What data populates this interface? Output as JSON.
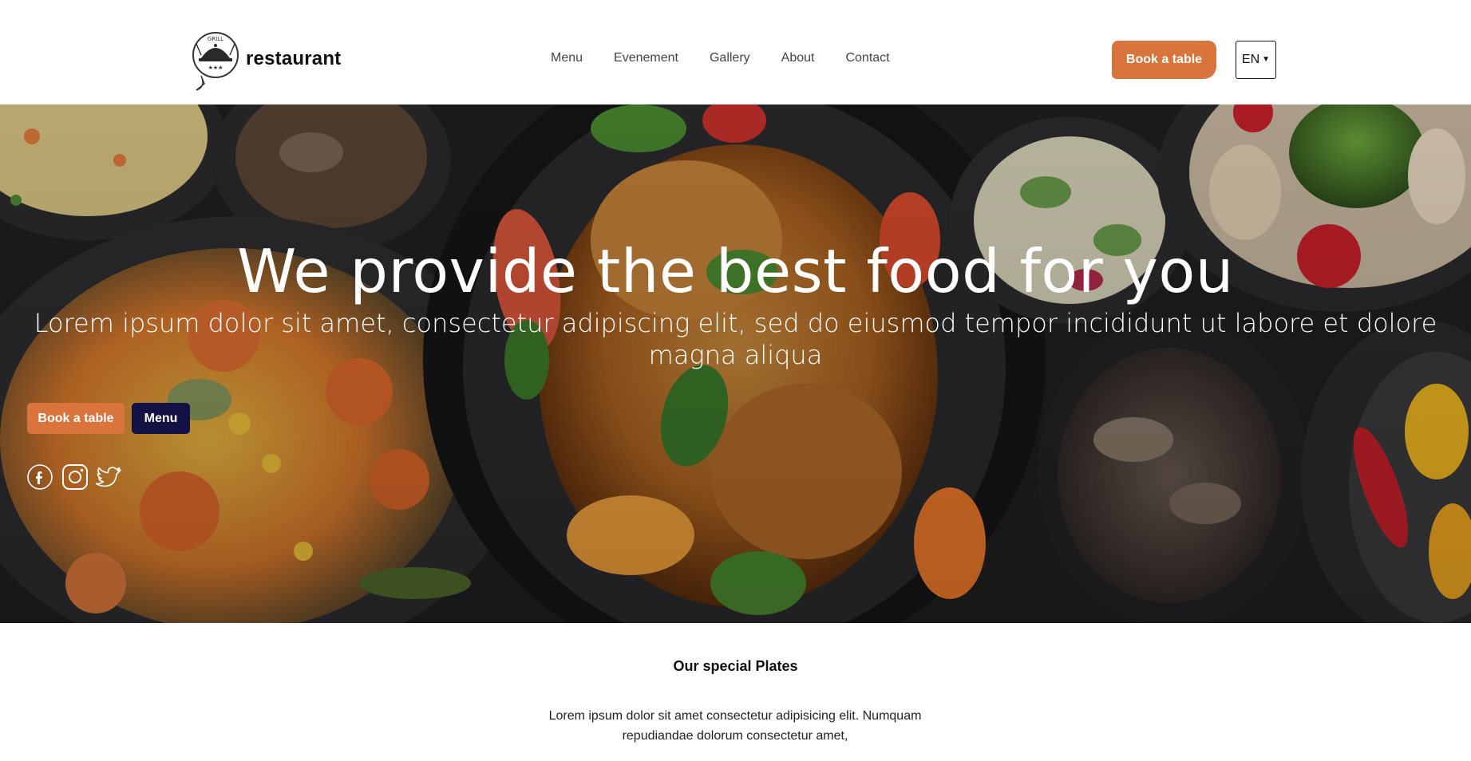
{
  "header": {
    "brand": "restaurant",
    "logo_badge": {
      "text": "GRILL",
      "icon": "cloche-icon"
    },
    "nav": [
      "Menu",
      "Evenement",
      "Gallery",
      "About",
      "Contact"
    ],
    "book_label": "Book a table",
    "language": "EN"
  },
  "hero": {
    "title": "We provide the best food for you",
    "subtitle": "Lorem ipsum dolor sit amet, consectetur adipiscing elit, sed do eiusmod tempor incididunt ut labore et dolore magna aliqua",
    "book_label": "Book a table",
    "menu_label": "Menu",
    "social": [
      "facebook-icon",
      "instagram-icon",
      "twitter-icon"
    ]
  },
  "specials": {
    "title": "Our special Plates",
    "text": "Lorem ipsum dolor sit amet consectetur adipisicing elit. Numquam repudiandae dolorum consectetur amet,"
  },
  "colors": {
    "accent": "#d9743c",
    "navy": "#141244",
    "hero_bg": "#1c1c1e"
  }
}
